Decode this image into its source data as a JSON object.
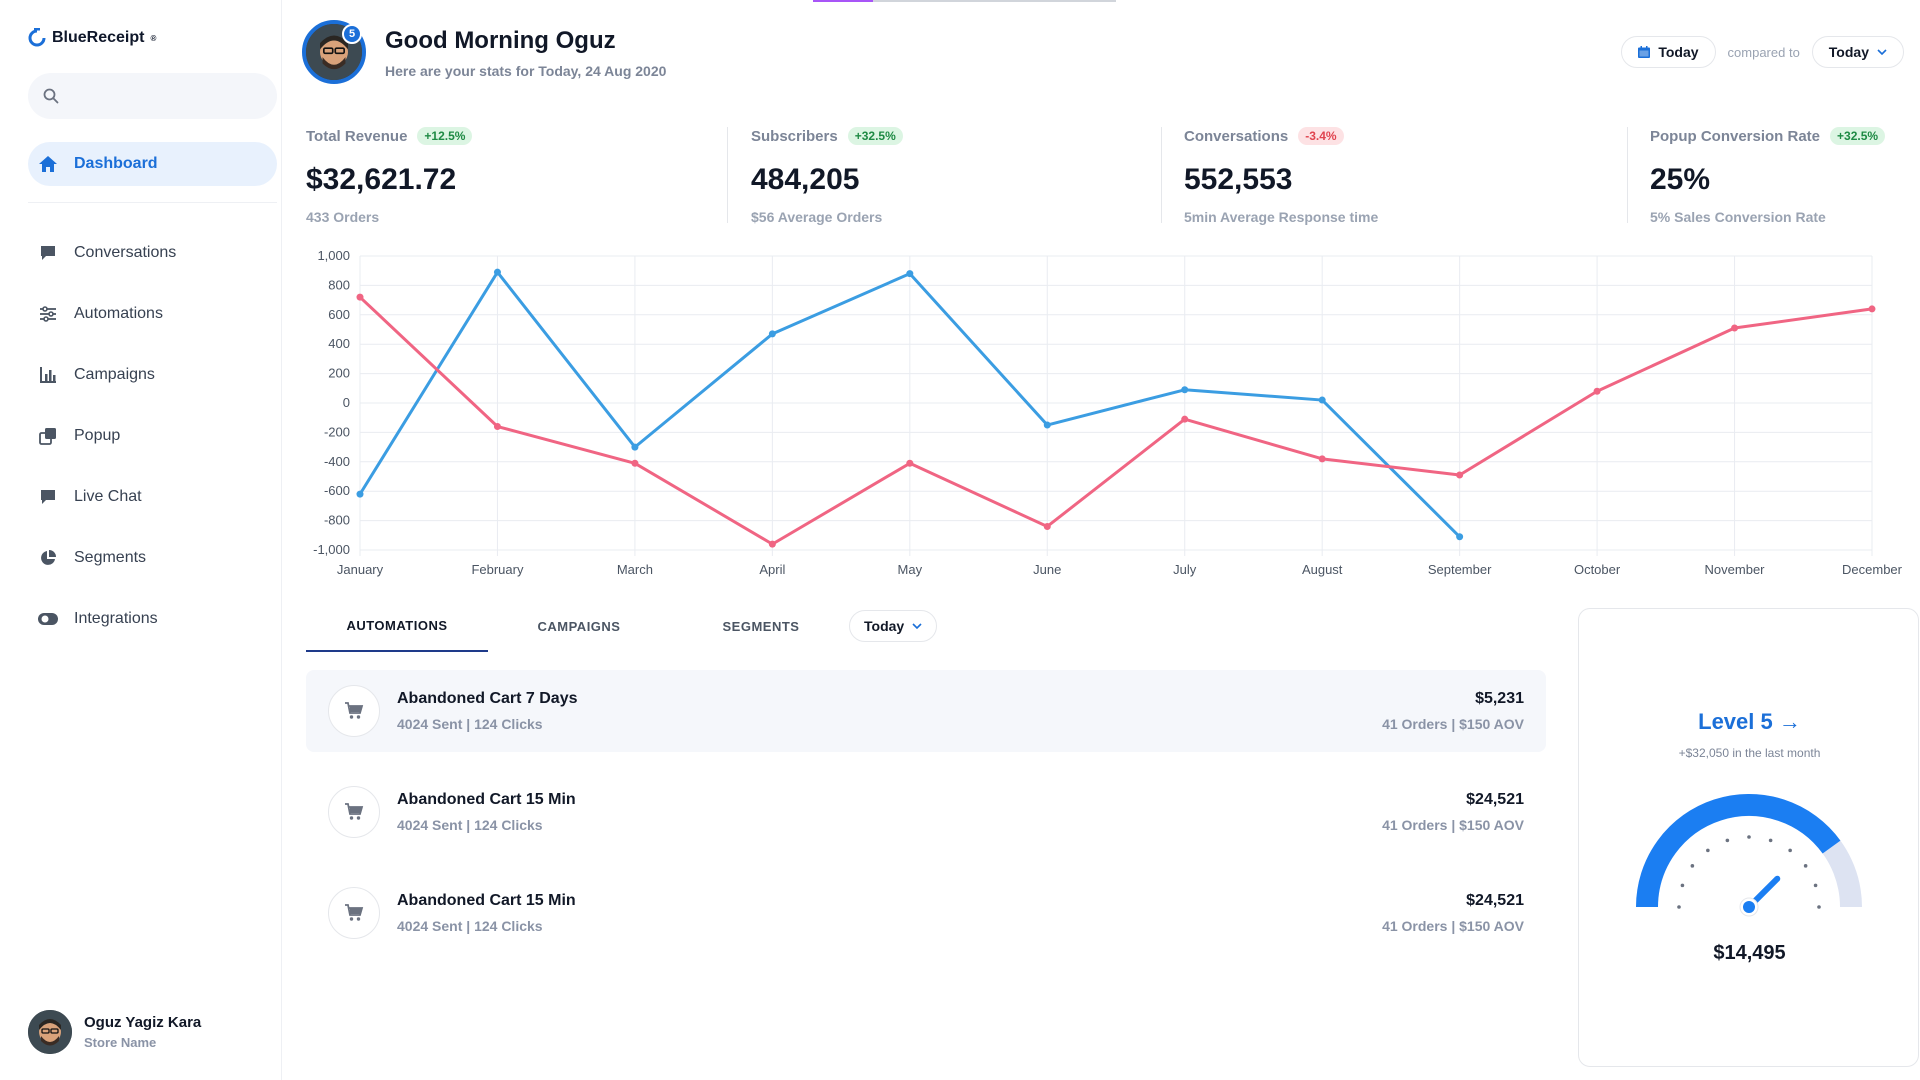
{
  "brand": {
    "name": "BlueReceipt"
  },
  "search": {
    "placeholder": ""
  },
  "sidebar": {
    "active": {
      "label": "Dashboard",
      "icon": "home-icon"
    },
    "items": [
      {
        "label": "Conversations",
        "icon": "chat-bubble-icon"
      },
      {
        "label": "Automations",
        "icon": "sliders-icon"
      },
      {
        "label": "Campaigns",
        "icon": "bar-chart-icon"
      },
      {
        "label": "Popup",
        "icon": "popup-icon"
      },
      {
        "label": "Live Chat",
        "icon": "chat-bubble-icon"
      },
      {
        "label": "Segments",
        "icon": "pie-chart-icon"
      },
      {
        "label": "Integrations",
        "icon": "toggle-icon"
      }
    ]
  },
  "profile": {
    "name": "Oguz Yagiz Kara",
    "store": "Store Name"
  },
  "header": {
    "badge": "5",
    "greeting": "Good Morning Oguz",
    "subtitle": "Here are your stats for Today, 24 Aug 2020",
    "date_button": "Today",
    "compared_label": "compared to",
    "compare_select": "Today"
  },
  "stats": [
    {
      "label": "Total Revenue",
      "change": "+12.5%",
      "trend": "up",
      "value": "$32,621.72",
      "sub": "433 Orders"
    },
    {
      "label": "Subscribers",
      "change": "+32.5%",
      "trend": "up",
      "value": "484,205",
      "sub": "$56 Average Orders"
    },
    {
      "label": "Conversations",
      "change": "-3.4%",
      "trend": "down",
      "value": "552,553",
      "sub": "5min Average Response time"
    },
    {
      "label": "Popup Conversion Rate",
      "change": "+32.5%",
      "trend": "up",
      "value": "25%",
      "sub": "5% Sales Conversion Rate"
    }
  ],
  "chart_data": {
    "type": "line",
    "categories": [
      "January",
      "February",
      "March",
      "April",
      "May",
      "June",
      "July",
      "August",
      "September",
      "October",
      "November",
      "December"
    ],
    "ylim": [
      -1000,
      1000
    ],
    "yticks": [
      "1,000",
      "800",
      "600",
      "400",
      "200",
      "0",
      "-200",
      "-400",
      "-600",
      "-800",
      "-1,000"
    ],
    "grid": true,
    "series": [
      {
        "color": "#3b9de2",
        "values": [
          -620,
          890,
          -300,
          470,
          880,
          -150,
          90,
          20,
          -910,
          null,
          null,
          null
        ]
      },
      {
        "color": "#f06583",
        "values": [
          720,
          -160,
          -410,
          -960,
          -410,
          -840,
          -110,
          -380,
          -490,
          80,
          510,
          640
        ]
      }
    ]
  },
  "tabs": {
    "items": [
      "AUTOMATIONS",
      "CAMPAIGNS",
      "SEGMENTS"
    ],
    "active": "AUTOMATIONS",
    "select": "Today"
  },
  "automations": [
    {
      "title": "Abandoned Cart 7 Days",
      "meta": "4024 Sent | 124 Clicks",
      "amount": "$5,231",
      "orders": "41 Orders | $150 AOV"
    },
    {
      "title": "Abandoned Cart 15 Min",
      "meta": "4024 Sent | 124 Clicks",
      "amount": "$24,521",
      "orders": "41 Orders | $150 AOV"
    },
    {
      "title": "Abandoned Cart 15 Min",
      "meta": "4024 Sent | 124 Clicks",
      "amount": "$24,521",
      "orders": "41 Orders | $150 AOV"
    }
  ],
  "level": {
    "title": "Level 5",
    "subtitle": "+$32,050 in the last month",
    "amount": "$14,495",
    "progress": 0.8
  },
  "colors": {
    "accent": "#1b6fd8",
    "up": "#1e8a44",
    "down": "#e0444f",
    "series_blue": "#3b9de2",
    "series_pink": "#f06583"
  }
}
